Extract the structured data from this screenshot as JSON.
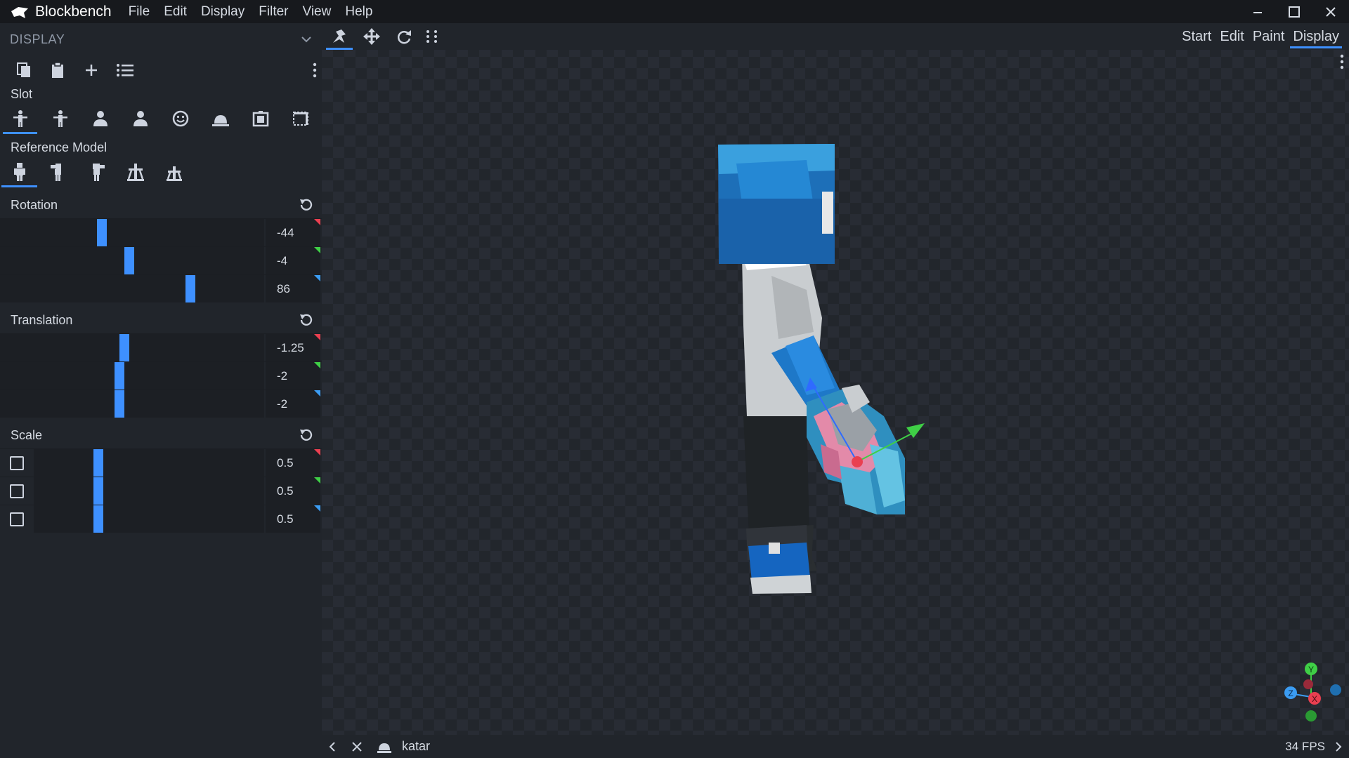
{
  "app": {
    "name": "Blockbench"
  },
  "menu": [
    "File",
    "Edit",
    "Display",
    "Filter",
    "View",
    "Help"
  ],
  "panel": {
    "title": "DISPLAY",
    "slot_label": "Slot",
    "reference_label": "Reference Model",
    "rotation_label": "Rotation",
    "translation_label": "Translation",
    "scale_label": "Scale"
  },
  "rotation": {
    "x": "-44",
    "y": "-4",
    "z": "86"
  },
  "translation": {
    "x": "-1.25",
    "y": "-2",
    "z": "-2"
  },
  "scale": {
    "x": "0.5",
    "y": "0.5",
    "z": "0.5"
  },
  "sliders": {
    "rotation": [
      0.38,
      0.49,
      0.73
    ],
    "translation": [
      0.47,
      0.45,
      0.45
    ],
    "scale": [
      0.27,
      0.27,
      0.27
    ]
  },
  "modes": [
    "Start",
    "Edit",
    "Paint",
    "Display"
  ],
  "active_mode": "Display",
  "status": {
    "model_name": "katar",
    "fps": "34 FPS"
  },
  "gizmo": {
    "y": "Y",
    "z": "Z",
    "x": "X"
  },
  "colors": {
    "accent": "#3e90ff",
    "x_axis": "#e93f50",
    "y_axis": "#3fcf46",
    "z_axis": "#3b9cf2"
  }
}
